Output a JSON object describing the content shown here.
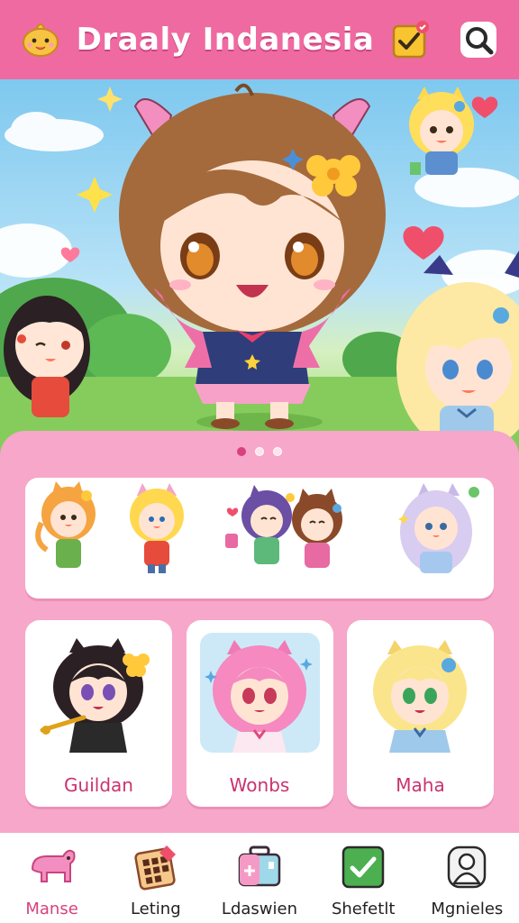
{
  "header": {
    "title": "Draaly Indanesia",
    "menu_icon": "chick-mascot-icon",
    "task_icon": "checklist-icon",
    "search_icon": "search-icon"
  },
  "carousel": {
    "pages": 3,
    "active_page": 1
  },
  "cards": [
    {
      "label": "Guildan"
    },
    {
      "label": "Wonbs"
    },
    {
      "label": "Maha"
    }
  ],
  "nav": {
    "active": 0,
    "items": [
      {
        "label": "Manse",
        "icon": "pink-animal-icon"
      },
      {
        "label": "Leting",
        "icon": "sticker-grid-icon"
      },
      {
        "label": "Ldaswien",
        "icon": "suitcase-icon"
      },
      {
        "label": "Shefetlt",
        "icon": "checkbox-icon"
      },
      {
        "label": "Mgnieles",
        "icon": "profile-icon"
      }
    ]
  },
  "colors": {
    "header": "#ef6aa0",
    "panel": "#f7a7c9",
    "accent": "#d9407f",
    "card_label": "#c9336f"
  }
}
